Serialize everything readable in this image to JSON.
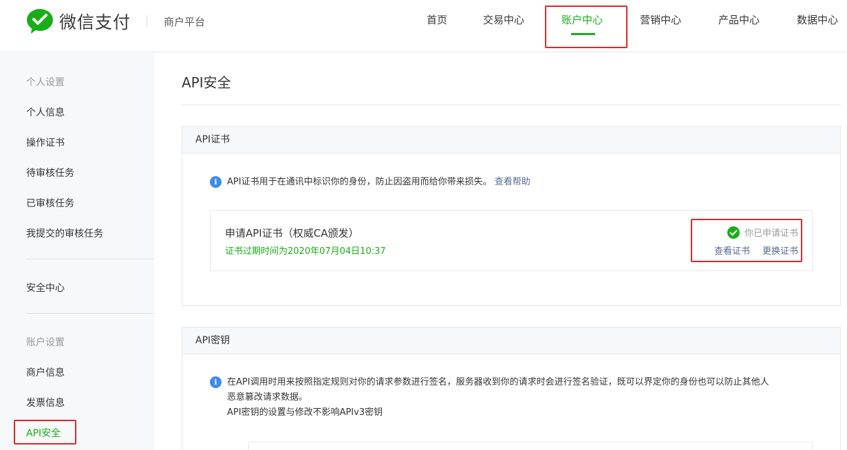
{
  "header": {
    "brand": "微信支付",
    "platform": "商户平台",
    "nav": [
      "首页",
      "交易中心",
      "账户中心",
      "营销中心",
      "产品中心",
      "数据中心"
    ],
    "active_nav": "账户中心"
  },
  "sidebar": {
    "personal_category": "个人设置",
    "personal_items": [
      "个人信息",
      "操作证书",
      "待审核任务",
      "已审核任务",
      "我提交的审核任务"
    ],
    "security_center": "安全中心",
    "account_category": "账户设置",
    "account_items": [
      "商户信息",
      "发票信息",
      "API安全"
    ],
    "active_item": "API安全"
  },
  "main": {
    "title": "API安全",
    "cert_panel": {
      "header": "API证书",
      "notice": "API证书用于在通讯中标识你的身份，防止因盗用而给你带来损失。",
      "help_link": "查看帮助",
      "card": {
        "title": "申请API证书（权威CA颁发）",
        "expire": "证书过期时间为2020年07月04日10:37",
        "status": "你已申请证书",
        "view_link": "查看证书",
        "replace_link": "更换证书"
      }
    },
    "key_panel": {
      "header": "API密钥",
      "notice_line1": "在API调用时用来按照指定规则对你的请求参数进行签名，服务器收到你的请求时会进行签名验证，既可以界定你的身份也可以防止其他人",
      "notice_line2": "恶意篡改请求数据。",
      "notice_line3": "API密钥的设置与修改不影响APIv3密钥"
    }
  },
  "colors": {
    "accent": "#1aad19",
    "link": "#576b95",
    "info": "#3e8bea",
    "highlight": "#e0272a"
  }
}
